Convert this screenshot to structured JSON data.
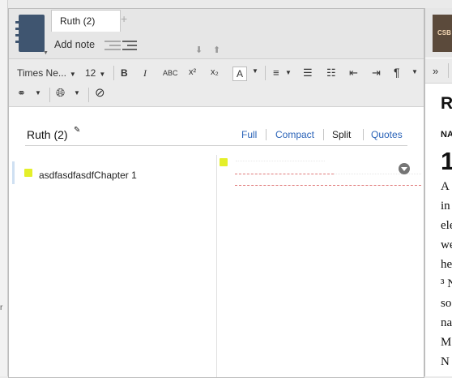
{
  "notes_window": {
    "tab_title": "Ruth (2)",
    "tab_add": "+",
    "add_note_label": "Add note"
  },
  "format_bar": {
    "font_family": "Times Ne...",
    "font_size": "12",
    "bold": "B",
    "italic": "I",
    "smallcaps": "ABC",
    "superscript": "x²",
    "subscript": "x₂",
    "text_color": "A",
    "paragraph_mark": "¶"
  },
  "notebook": {
    "title": "Ruth (2)",
    "views": [
      {
        "label": "Full",
        "active": false
      },
      {
        "label": "Compact",
        "active": false
      },
      {
        "label": "Split",
        "active": true
      },
      {
        "label": "Quotes",
        "active": false
      }
    ]
  },
  "notes": [
    {
      "label": "asdfasdfasdfChapter 1"
    }
  ],
  "reader": {
    "more_label": "»",
    "text_lines": [
      "R",
      "NA",
      "1",
      "A",
      "in",
      "ele",
      "we",
      "he",
      "³ N",
      "so",
      "na",
      "M",
      "N"
    ]
  },
  "colors": {
    "note_marker": "#e4ef2a",
    "link_blue": "#2a63b8",
    "notebook_icon": "#3f5570",
    "dashed_red": "#e07a7a"
  }
}
